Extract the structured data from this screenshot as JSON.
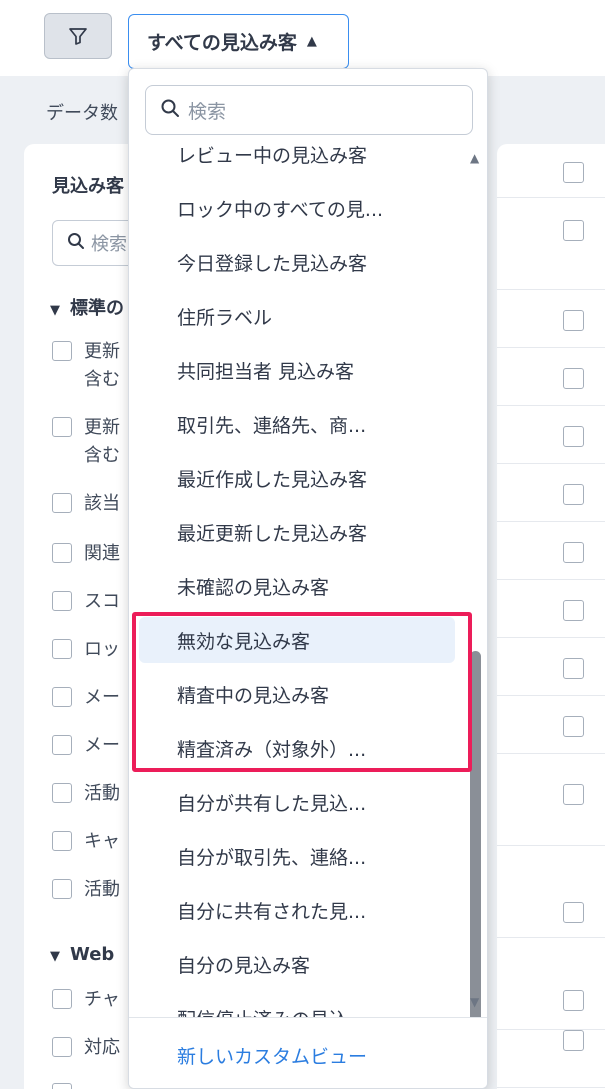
{
  "topbar": {
    "view_label": "すべての見込み客",
    "caret": "▲"
  },
  "count_label": "データ数",
  "left_panel": {
    "title": "見込み客",
    "search_placeholder": "検索",
    "section_standard": "標準の",
    "items_standard": [
      "更新",
      "更新",
      "該当",
      "関連",
      "スコ",
      "ロッ",
      "メー",
      "メー",
      "活動",
      "キャ",
      "活動"
    ],
    "item_suffix": "含む",
    "section_web": "Web",
    "items_web": [
      "チャ",
      "対応"
    ]
  },
  "dropdown": {
    "search_placeholder": "検索",
    "items": [
      "レビュー中の見込み客",
      "ロック中のすべての見...",
      "今日登録した見込み客",
      "住所ラベル",
      "共同担当者 見込み客",
      "取引先、連絡先、商...",
      "最近作成した見込み客",
      "最近更新した見込み客",
      "未確認の見込み客",
      "無効な見込み客",
      "精査中の見込み客",
      "精査済み（対象外）...",
      "自分が共有した見込...",
      "自分が取引先、連絡...",
      "自分に共有された見...",
      "自分の見込み客",
      "配信停止済みの見込"
    ],
    "highlighted_index": 9,
    "footer_link": "新しいカスタムビュー"
  },
  "colors": {
    "accent": "#2b7de0",
    "highlight_border": "#ec1d59",
    "hover_bg": "#e9f1fb"
  }
}
